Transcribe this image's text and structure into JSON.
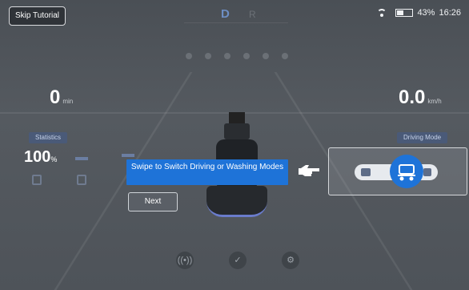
{
  "header": {
    "skip_label": "Skip Tutorial",
    "gear_active": "D",
    "gear_other": "R",
    "battery_percent": "43%",
    "battery_level": 0.43,
    "time": "16:26"
  },
  "metrics": {
    "time_value": "0",
    "time_unit": "min",
    "speed_value": "0.0",
    "speed_unit": "km/h"
  },
  "left_panel": {
    "label": "Statistics",
    "percent_value": "100",
    "percent_unit": "%"
  },
  "right_panel": {
    "label": "Driving Mode"
  },
  "tutorial": {
    "message": "Swipe to Switch Driving or Washing Modes",
    "next_label": "Next"
  },
  "colors": {
    "accent": "#1e73d8",
    "background": "#4e5359"
  },
  "icons": {
    "wifi": "wifi-icon",
    "battery": "battery-icon",
    "pointer": "hand-pointer-icon",
    "signal": "signal-broadcast-icon",
    "checklist": "clipboard-check-icon",
    "settings": "gear-icon"
  }
}
